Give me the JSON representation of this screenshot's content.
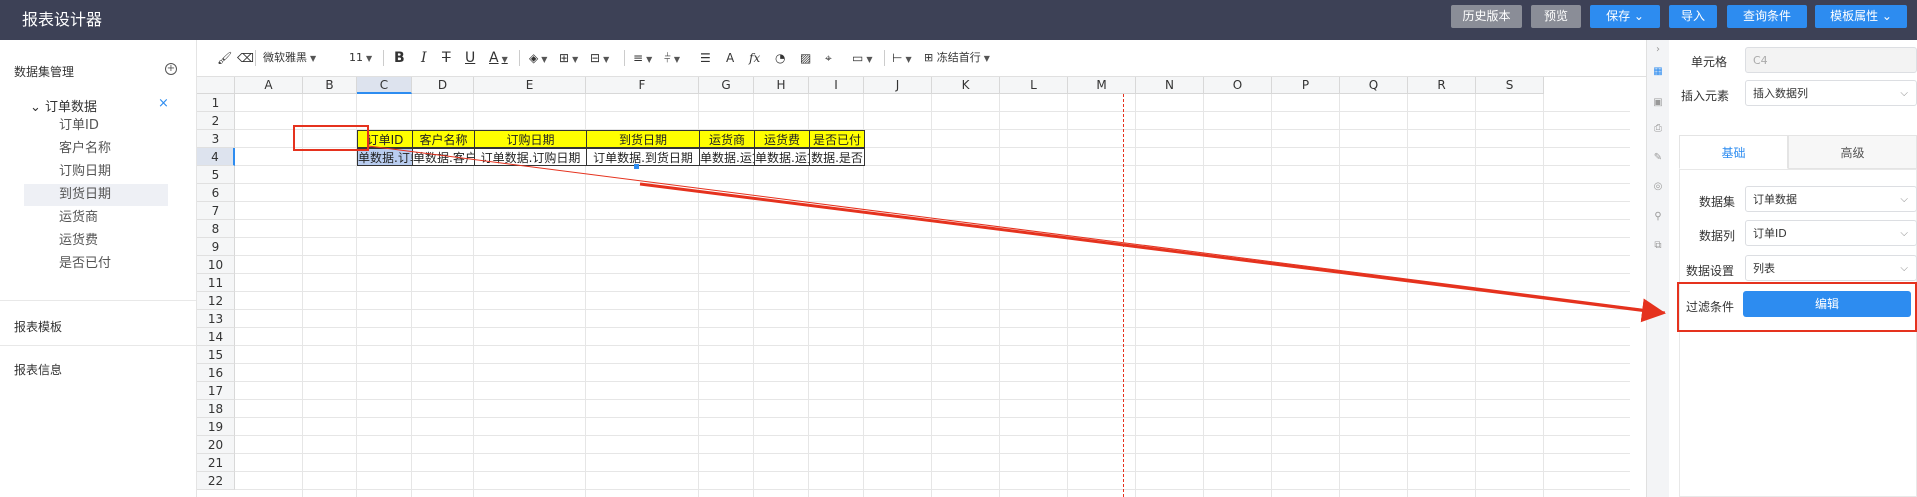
{
  "app": {
    "title": "报表设计器"
  },
  "header_buttons": [
    {
      "label": "历史版本",
      "style": "gray"
    },
    {
      "label": "预览",
      "style": "gray"
    },
    {
      "label": "保存 ⌄",
      "style": "blue"
    },
    {
      "label": "导入",
      "style": "blue"
    },
    {
      "label": "查询条件",
      "style": "blue"
    },
    {
      "label": "模板属性 ⌄",
      "style": "blue"
    }
  ],
  "left_panel": {
    "dataset_title": "数据集管理",
    "add_icon": "plus-circle-icon",
    "tree_root": "⌄ 订单数据",
    "tree_close": "×",
    "fields": [
      "订单ID",
      "客户名称",
      "订购日期",
      "到货日期",
      "运货商",
      "运货费",
      "是否已付"
    ],
    "selected_field": "到货日期",
    "template_title": "报表模板",
    "info_title": "报表信息"
  },
  "toolbar": {
    "font_family": "微软雅黑",
    "font_size": "11",
    "freeze": "冻结首行"
  },
  "sheet": {
    "columns": [
      "A",
      "B",
      "C",
      "D",
      "E",
      "F",
      "G",
      "H",
      "I",
      "J",
      "K",
      "L",
      "M",
      "N",
      "O",
      "P",
      "Q",
      "R",
      "S"
    ],
    "rows": [
      "1",
      "2",
      "3",
      "4",
      "5",
      "6",
      "7",
      "8",
      "9",
      "10",
      "11",
      "12",
      "13",
      "14",
      "15",
      "16",
      "17",
      "18",
      "19",
      "20",
      "21",
      "22"
    ],
    "active_column": "C",
    "active_row": "4",
    "header_cells": [
      "订单ID",
      "客户名称",
      "订购日期",
      "到货日期",
      "运货商",
      "运货费",
      "是否已付"
    ],
    "value_cells": [
      "单数据.订单",
      "单数据.客户名",
      "订单数据.订购日期",
      "订单数据.到货日期",
      "单数据.运货",
      "单数据.运货",
      "数据.是否"
    ],
    "header_fill": "#ffff00",
    "highlight_color": "#e5321e"
  },
  "right_panel": {
    "cell_label": "单元格",
    "cell_value": "C4",
    "insert_label": "插入元素",
    "insert_value": "插入数据列",
    "tabs": [
      "基础",
      "高级"
    ],
    "active_tab": "基础",
    "dataset_label": "数据集",
    "dataset_value": "订单数据",
    "column_label": "数据列",
    "column_value": "订单ID",
    "setting_label": "数据设置",
    "setting_value": "列表",
    "filter_label": "过滤条件",
    "edit_button": "编辑"
  }
}
